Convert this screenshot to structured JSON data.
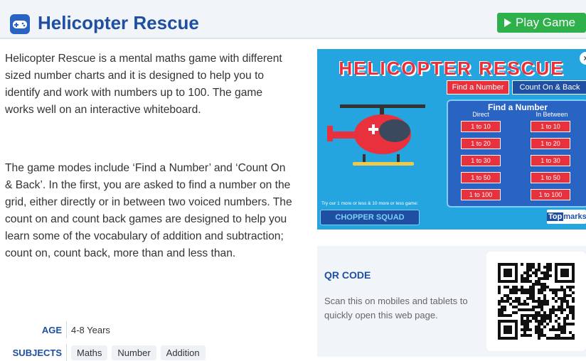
{
  "header": {
    "title": "Helicopter Rescue",
    "play_label": "Play Game",
    "icon": "gamepad-icon"
  },
  "description": {
    "p1": "Helicopter Rescue is a mental maths game with different sized number charts and it is designed to help you to identify and work with numbers up to 100. The game works well on an interactive whiteboard.",
    "p2": "The game modes include ‘Find a Number’ and ‘Count On & Back’. In the first, you are asked to find a number on the grid, either directly or in between two voiced numbers. The count on and count back games are designed to help you learn some of the vocabulary of addition and subtraction; count on, count back, more than and less than."
  },
  "meta": {
    "age_key": "AGE",
    "age_value": "4-8 Years",
    "subjects_key": "SUBJECTS",
    "subjects": [
      "Maths",
      "Number",
      "Addition"
    ]
  },
  "game": {
    "title": "HELICOPTER RESCUE",
    "close_label": "×",
    "mode_find": "Find a Number",
    "mode_count": "Count On & Back",
    "panel_title": "Find a Number",
    "col_direct": "Direct",
    "col_between": "In Between",
    "ranges": [
      "1 to 10",
      "1 to 20",
      "1 to 30",
      "1 to 50",
      "1 to 100"
    ],
    "hint": "Try our 1 more or less & 10 more or less game:",
    "chopper_label": "CHOPPER SQUAD",
    "brand_top": "Top",
    "brand_marks": "marks"
  },
  "qr": {
    "title": "QR CODE",
    "text": "Scan this on mobiles and tablets to quickly open this web page."
  },
  "colors": {
    "brand_blue": "#1f4fa3",
    "play_green": "#2eb04b",
    "game_red": "#e8313c",
    "game_sky": "#25a5e0"
  }
}
